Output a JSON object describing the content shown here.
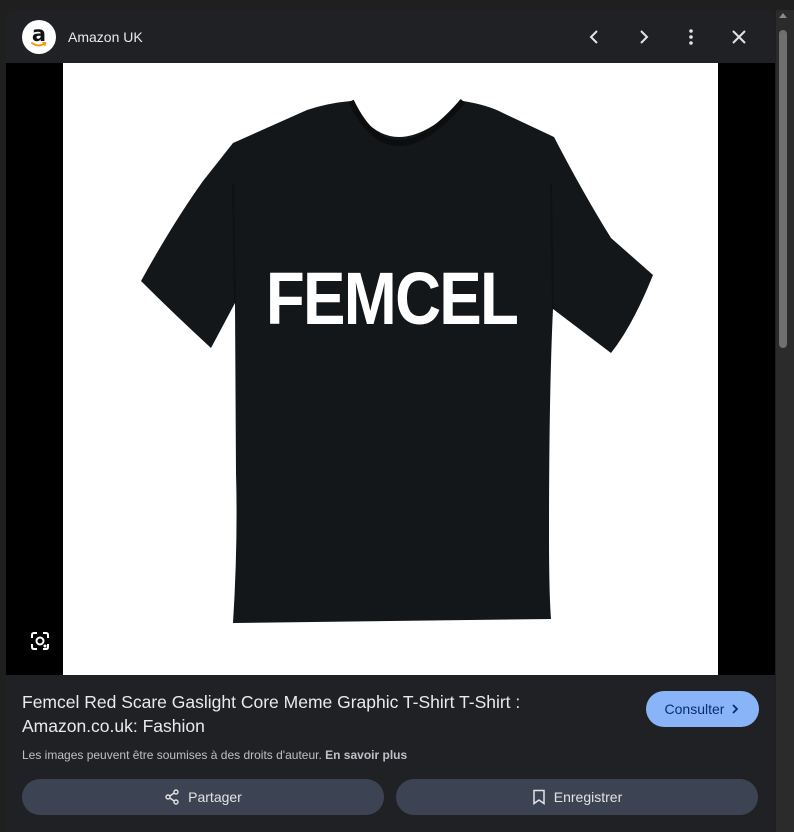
{
  "header": {
    "logo_letter": "a",
    "site_name": "Amazon UK",
    "icons": [
      "chevron-left-icon",
      "chevron-right-icon",
      "more-vert-icon",
      "close-icon"
    ]
  },
  "image": {
    "shirt_text": "FEMCEL",
    "lens_icon": "lens-icon"
  },
  "info": {
    "title": "Femcel Red Scare Gaslight Core Meme Graphic T-Shirt T-Shirt : Amazon.co.uk: Fashion",
    "consult_label": "Consulter",
    "copyright_text": "Les images peuvent être soumises à des droits d'auteur.",
    "learn_more": "En savoir plus"
  },
  "actions": {
    "share_label": "Partager",
    "save_label": "Enregistrer"
  },
  "colors": {
    "background": "#202124",
    "accent_button": "#8ab4f8",
    "action_button": "#3c4454"
  }
}
